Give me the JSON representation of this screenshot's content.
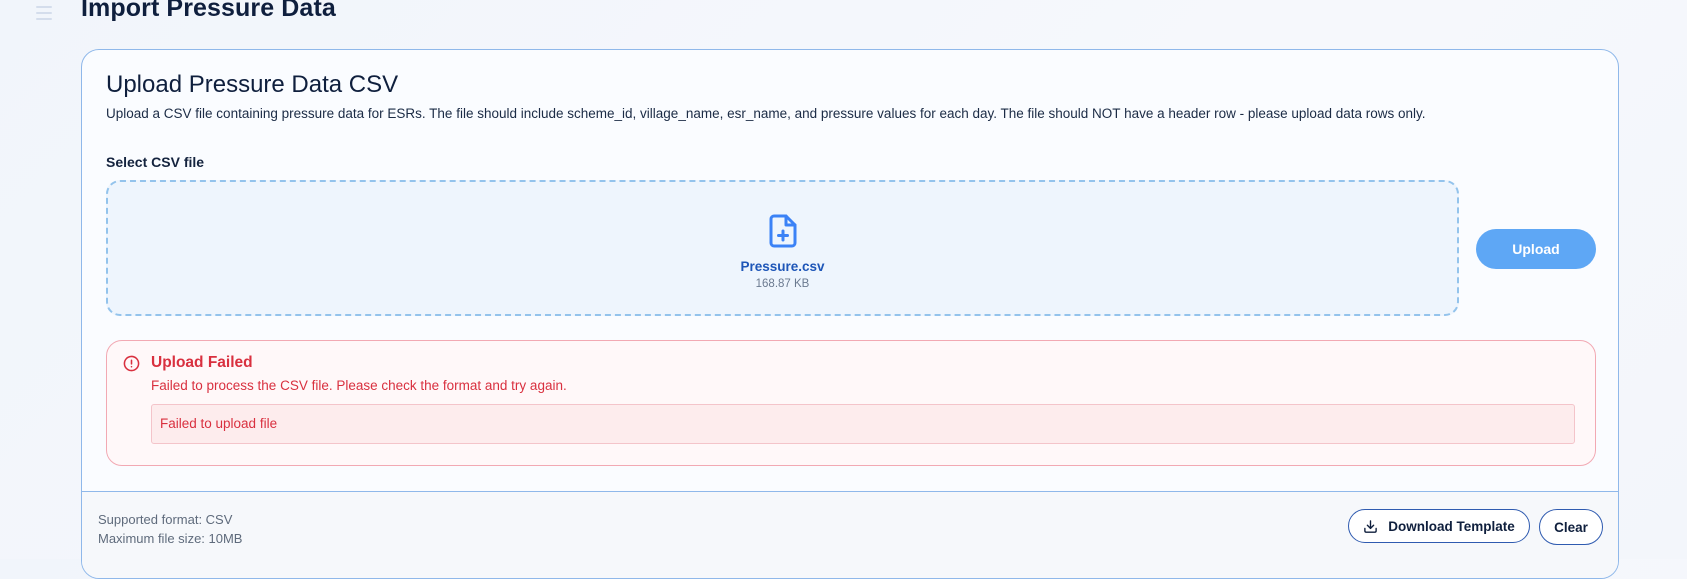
{
  "page": {
    "title": "Import Pressure Data"
  },
  "card": {
    "title": "Upload Pressure Data CSV",
    "description": "Upload a CSV file containing pressure data for ESRs. The file should include scheme_id, village_name, esr_name, and pressure values for each day. The file should NOT have a header row - please upload data rows only."
  },
  "upload": {
    "field_label": "Select CSV file",
    "file_name": "Pressure.csv",
    "file_size": "168.87 KB",
    "button_label": "Upload",
    "file_icon": "file-plus-icon"
  },
  "error": {
    "icon": "alert-circle-icon",
    "title": "Upload Failed",
    "message": "Failed to process the CSV file. Please check the format and try again.",
    "detail": "Failed to upload file"
  },
  "footer": {
    "supported_format": "Supported format: CSV",
    "max_size": "Maximum file size: 10MB",
    "download_label": "Download Template",
    "download_icon": "download-icon",
    "clear_label": "Clear"
  },
  "colors": {
    "accent": "#5ea7f5",
    "link_text": "#1e56b8",
    "error": "#d9303f",
    "border": "#8fb8ea"
  }
}
